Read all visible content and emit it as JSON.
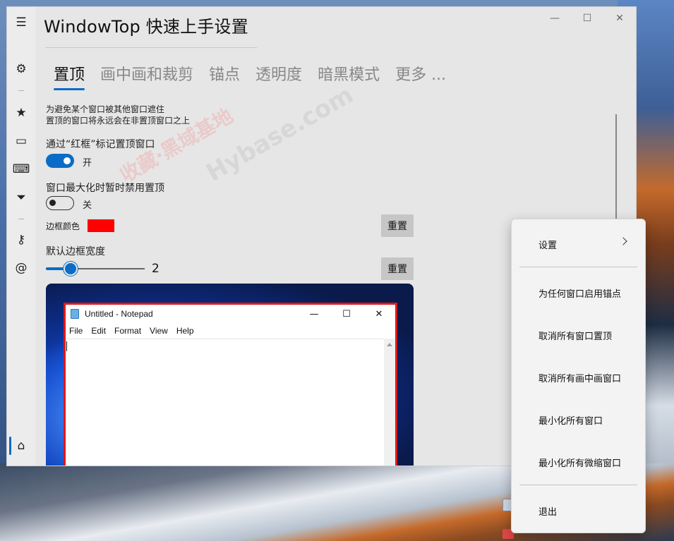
{
  "app": {
    "title": "WindowTop 快速上手设置"
  },
  "window_controls": {
    "minimize": "—",
    "maximize": "☐",
    "close": "✕"
  },
  "sidebar": {
    "items": [
      {
        "name": "menu-icon",
        "glyph": "☰"
      },
      {
        "name": "gear-icon",
        "glyph": "⚙"
      },
      {
        "name": "star-icon",
        "glyph": "★"
      },
      {
        "name": "window-icon",
        "glyph": "▭"
      },
      {
        "name": "keyboard-icon",
        "glyph": "⌨"
      },
      {
        "name": "filter-icon",
        "glyph": "⏷"
      },
      {
        "name": "key-icon",
        "glyph": "⚷"
      },
      {
        "name": "at-icon",
        "glyph": "@"
      },
      {
        "name": "home-icon",
        "glyph": "⌂"
      }
    ]
  },
  "tabs": [
    {
      "label": "置顶",
      "active": true
    },
    {
      "label": "画中画和裁剪",
      "active": false
    },
    {
      "label": "锚点",
      "active": false
    },
    {
      "label": "透明度",
      "active": false
    },
    {
      "label": "暗黑模式",
      "active": false
    },
    {
      "label": "更多 ...",
      "active": false
    }
  ],
  "pin_tab": {
    "desc_line1": "为避免某个窗口被其他窗口遮住",
    "desc_line2": "置顶的窗口将永远会在非置顶窗口之上",
    "red_border_label": "通过“红框”标记置顶窗口",
    "red_border_toggle": true,
    "red_border_state": "开",
    "maximize_label": "窗口最大化时暂时禁用置顶",
    "maximize_toggle": false,
    "maximize_state": "关",
    "border_color_label": "边框颜色",
    "border_color": "#ff0000",
    "reset_label": "重置",
    "border_width_label": "默认边框宽度",
    "border_width_value": "2",
    "border_width_fraction": 0.25
  },
  "preview": {
    "notepad_title": "Untitled - Notepad",
    "menu": [
      "File",
      "Edit",
      "Format",
      "View",
      "Help"
    ]
  },
  "watermark": {
    "text1": "收藏·黑域基地",
    "text2": "Hybase.com"
  },
  "context_menu": {
    "items": [
      {
        "label": "设置",
        "submenu": true
      },
      {
        "label": "为任何窗口启用锚点"
      },
      {
        "label": "取消所有窗口置顶"
      },
      {
        "label": "取消所有画中画窗口"
      },
      {
        "label": "最小化所有窗口"
      },
      {
        "label": "最小化所有微缩窗口"
      },
      {
        "label": "退出"
      }
    ]
  }
}
